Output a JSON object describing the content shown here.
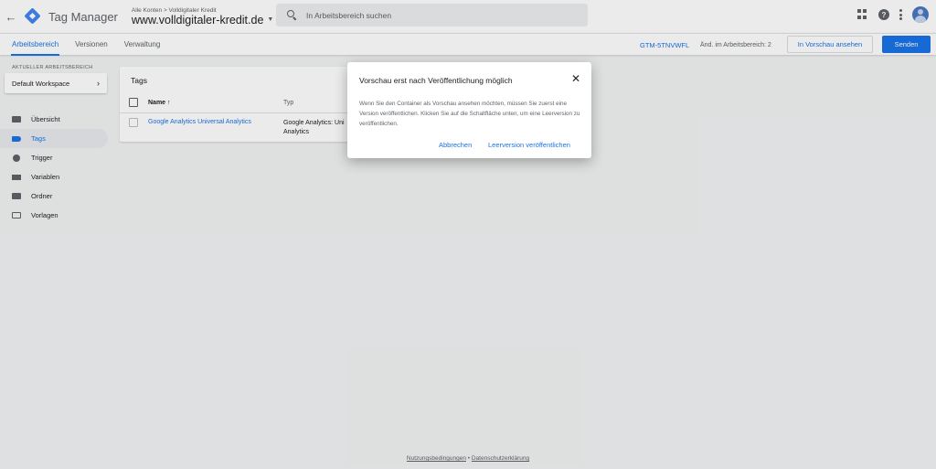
{
  "header": {
    "app_title": "Tag Manager",
    "breadcrumb": "Alle Konten > Volldigitaler Kredit",
    "container_name": "www.volldigitaler-kredit.de",
    "search_placeholder": "In Arbeitsbereich suchen"
  },
  "subnav": {
    "tabs": [
      {
        "label": "Arbeitsbereich",
        "active": true
      },
      {
        "label": "Versionen",
        "active": false
      },
      {
        "label": "Verwaltung",
        "active": false
      }
    ],
    "container_id": "GTM-5TNVWFL",
    "changes": "Änd. im Arbeitsbereich: 2",
    "preview_label": "In Vorschau ansehen",
    "submit_label": "Senden"
  },
  "sidebar": {
    "workspace_label": "AKTUELLER ARBEITSBEREICH",
    "workspace_name": "Default Workspace",
    "items": [
      {
        "label": "Übersicht",
        "icon": "overview-icon"
      },
      {
        "label": "Tags",
        "icon": "tag-icon",
        "active": true
      },
      {
        "label": "Trigger",
        "icon": "trigger-icon"
      },
      {
        "label": "Variablen",
        "icon": "variables-icon"
      },
      {
        "label": "Ordner",
        "icon": "folder-icon"
      },
      {
        "label": "Vorlagen",
        "icon": "templates-icon"
      }
    ]
  },
  "tags_card": {
    "title": "Tags",
    "col_name": "Name ↑",
    "col_type": "Typ",
    "rows": [
      {
        "name": "Google Analytics Universal Analytics",
        "type_line1": "Google Analytics: Uni",
        "type_line2": "Analytics"
      }
    ]
  },
  "dialog": {
    "title": "Vorschau erst nach Veröffentlichung möglich",
    "body": "Wenn Sie den Container als Vorschau ansehen möchten, müssen Sie zuerst eine Version veröffentlichen. Klicken Sie auf die Schaltfläche unten, um eine Leerversion zu veröffentlichen.",
    "cancel_label": "Abbrechen",
    "publish_label": "Leerversion veröffentlichen",
    "close_glyph": "✕"
  },
  "footer": {
    "terms": "Nutzungsbedingungen",
    "separator": " • ",
    "privacy": "Datenschutzerklärung"
  },
  "colors": {
    "accent": "#1a73e8",
    "background": "#f1f3f4"
  }
}
